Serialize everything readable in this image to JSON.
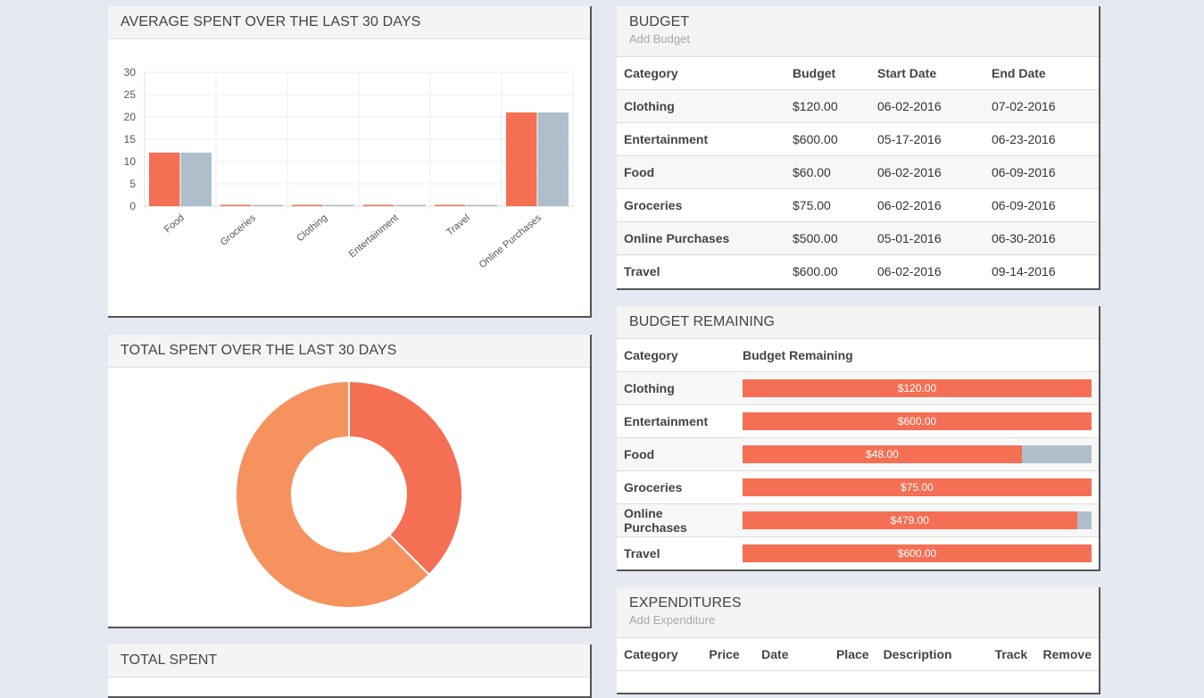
{
  "avg_panel": {
    "title": "AVERAGE SPENT OVER THE LAST 30 DAYS"
  },
  "total_panel": {
    "title": "TOTAL SPENT OVER THE LAST 30 DAYS"
  },
  "total_spent_panel": {
    "title": "TOTAL SPENT"
  },
  "budget_panel": {
    "title": "BUDGET",
    "add_link": "Add Budget",
    "headers": [
      "Category",
      "Budget",
      "Start Date",
      "End Date"
    ],
    "rows": [
      [
        "Clothing",
        "$120.00",
        "06-02-2016",
        "07-02-2016"
      ],
      [
        "Entertainment",
        "$600.00",
        "05-17-2016",
        "06-23-2016"
      ],
      [
        "Food",
        "$60.00",
        "06-02-2016",
        "06-09-2016"
      ],
      [
        "Groceries",
        "$75.00",
        "06-02-2016",
        "06-09-2016"
      ],
      [
        "Online Purchases",
        "$500.00",
        "05-01-2016",
        "06-30-2016"
      ],
      [
        "Travel",
        "$600.00",
        "06-02-2016",
        "09-14-2016"
      ]
    ]
  },
  "remaining_panel": {
    "title": "BUDGET REMAINING",
    "headers": [
      "Category",
      "Budget Remaining"
    ],
    "rows": [
      {
        "category": "Clothing",
        "label": "$120.00",
        "fraction": 1.0
      },
      {
        "category": "Entertainment",
        "label": "$600.00",
        "fraction": 1.0
      },
      {
        "category": "Food",
        "label": "$48.00",
        "fraction": 0.8
      },
      {
        "category": "Groceries",
        "label": "$75.00",
        "fraction": 1.0
      },
      {
        "category": "Online Purchases",
        "label": "$479.00",
        "fraction": 0.958
      },
      {
        "category": "Travel",
        "label": "$600.00",
        "fraction": 1.0
      }
    ]
  },
  "expenditures_panel": {
    "title": "EXPENDITURES",
    "add_link": "Add Expenditure",
    "headers": [
      "Category",
      "Price",
      "Date",
      "Place",
      "Description",
      "Track",
      "Remove"
    ]
  },
  "colors": {
    "primary": "#f46f54",
    "secondary": "#aebfcb",
    "donut_large": "#f6925e"
  },
  "chart_data": [
    {
      "type": "bar",
      "categories": [
        "Food",
        "Groceries",
        "Clothing",
        "Entertainment",
        "Travel",
        "Online Purchases"
      ],
      "series": [
        {
          "values": [
            12,
            0.3,
            0.3,
            0.3,
            0.3,
            21
          ],
          "color": "#f46f54"
        },
        {
          "values": [
            12,
            0.3,
            0.3,
            0.3,
            0.3,
            21
          ],
          "color": "#aebfcb"
        }
      ],
      "ylim": [
        0,
        30
      ],
      "yticks": [
        0,
        5,
        10,
        15,
        20,
        25,
        30
      ],
      "grid": true
    },
    {
      "type": "pie",
      "donut": true,
      "slices": [
        {
          "value": 37.5,
          "color": "#f46f54"
        },
        {
          "value": 62.5,
          "color": "#f6925e"
        }
      ]
    }
  ]
}
